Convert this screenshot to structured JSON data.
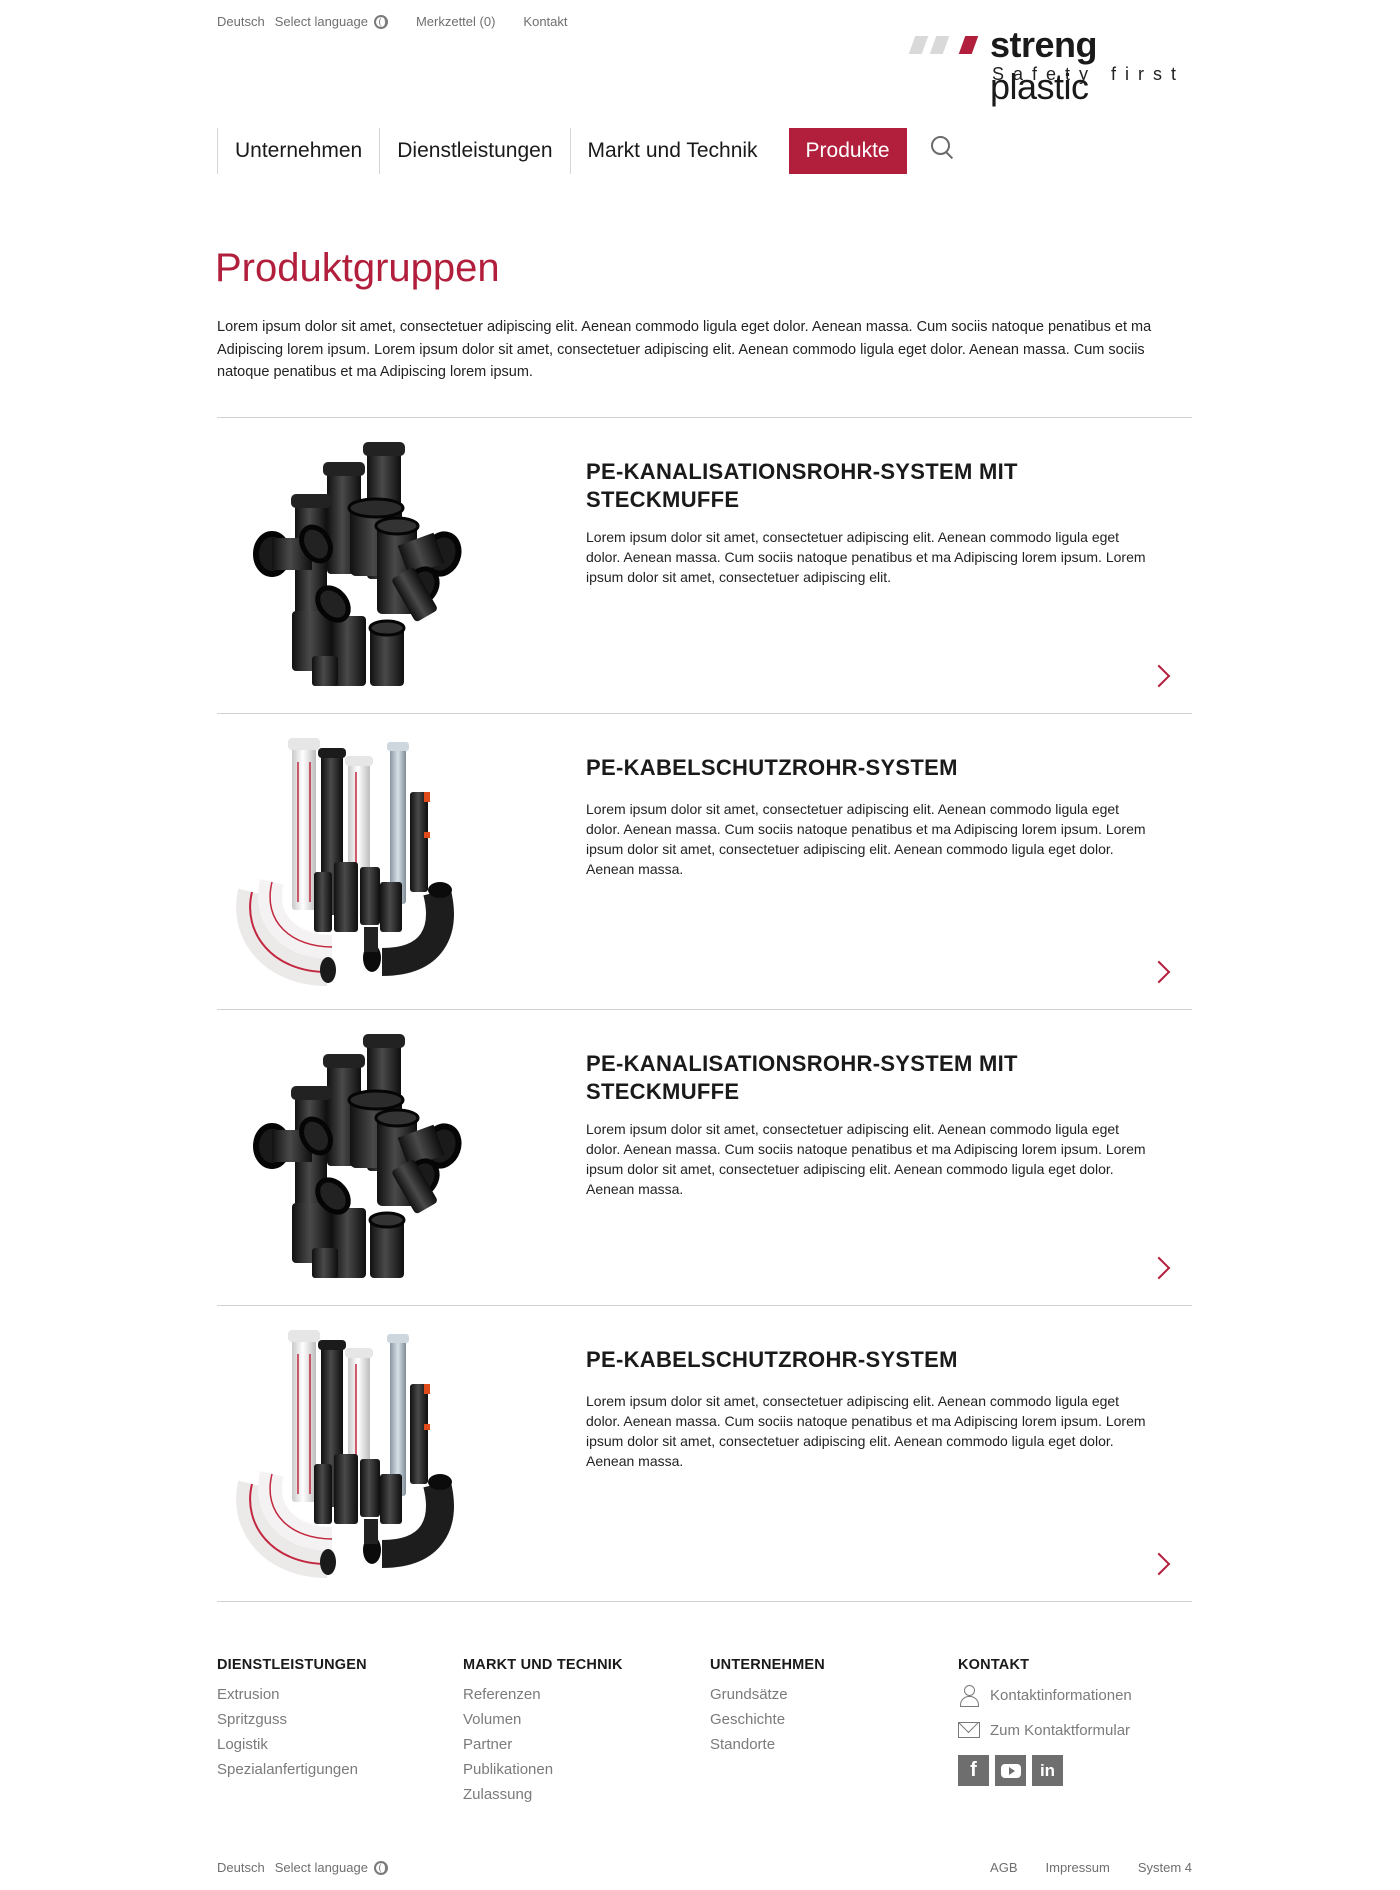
{
  "topbar": {
    "language": "Deutsch",
    "select_language": "Select language",
    "merkzettel": "Merkzettel (0)",
    "kontakt": "Kontakt"
  },
  "logo": {
    "brand_bold": "streng",
    "brand_light": " plastic",
    "tagline": "Safety first"
  },
  "nav": {
    "items": [
      "Unternehmen",
      "Dienstleistungen",
      "Markt und Technik"
    ],
    "active": "Produkte"
  },
  "main": {
    "title": "Produktgruppen",
    "intro": "Lorem ipsum dolor sit amet, consectetuer adipiscing elit. Aenean commodo ligula eget dolor. Aenean massa. Cum sociis natoque penatibus et ma Adipiscing lorem ipsum. Lorem ipsum dolor sit amet, consectetuer adipiscing elit. Aenean commodo ligula eget dolor. Aenean massa. Cum sociis natoque penatibus et ma Adipiscing lorem ipsum."
  },
  "products": [
    {
      "title": "PE-KANALISATIONSROHR-SYSTEM MIT STECKMUFFE",
      "description": "Lorem ipsum dolor sit amet, consectetuer adipiscing elit. Aenean commodo ligula eget dolor. Aenean massa. Cum sociis natoque penatibus et ma Adipiscing lorem ipsum. Lorem ipsum dolor sit amet, consectetuer adipiscing elit.",
      "image": "black-pipe-fittings"
    },
    {
      "title": "PE-KABELSCHUTZROHR-SYSTEM",
      "description": "Lorem ipsum dolor sit amet, consectetuer adipiscing elit. Aenean commodo ligula eget dolor. Aenean massa. Cum sociis natoque penatibus et ma Adipiscing lorem ipsum. Lorem ipsum dolor sit amet, consectetuer adipiscing elit. Aenean commodo ligula eget dolor. Aenean massa.",
      "image": "cable-protection-pipes"
    },
    {
      "title": "PE-KANALISATIONSROHR-SYSTEM MIT STECKMUFFE",
      "description": "Lorem ipsum dolor sit amet, consectetuer adipiscing elit. Aenean commodo ligula eget dolor. Aenean massa. Cum sociis natoque penatibus et ma Adipiscing lorem ipsum. Lorem ipsum dolor sit amet, consectetuer adipiscing elit. Aenean commodo ligula eget dolor. Aenean massa.",
      "image": "black-pipe-fittings"
    },
    {
      "title": "PE-KABELSCHUTZROHR-SYSTEM",
      "description": "Lorem ipsum dolor sit amet, consectetuer adipiscing elit. Aenean commodo ligula eget dolor. Aenean massa. Cum sociis natoque penatibus et ma Adipiscing lorem ipsum. Lorem ipsum dolor sit amet, consectetuer adipiscing elit. Aenean commodo ligula eget dolor. Aenean massa.",
      "image": "cable-protection-pipes"
    }
  ],
  "footer": {
    "dienstleistungen": {
      "heading": "DIENSTLEISTUNGEN",
      "links": [
        "Extrusion",
        "Spritzguss",
        "Logistik",
        "Spezialanfertigungen"
      ]
    },
    "markt": {
      "heading": "MARKT UND TECHNIK",
      "links": [
        "Referenzen",
        "Volumen",
        "Partner",
        "Publikationen",
        "Zulassung"
      ]
    },
    "unternehmen": {
      "heading": "UNTERNEHMEN",
      "links": [
        "Grundsätze",
        "Geschichte",
        "Standorte"
      ]
    },
    "kontakt": {
      "heading": "KONTAKT",
      "info": "Kontaktinformationen",
      "form": "Zum Kontaktformular",
      "social": [
        "facebook-icon",
        "youtube-icon",
        "linkedin-icon"
      ]
    }
  },
  "bottombar": {
    "language": "Deutsch",
    "select_language": "Select language",
    "links": [
      "AGB",
      "Impressum",
      "System 4"
    ]
  },
  "colors": {
    "accent": "#b21f3c",
    "text": "#1e1e1e",
    "muted": "#7b7b7b",
    "divider": "#d3d3d3"
  }
}
